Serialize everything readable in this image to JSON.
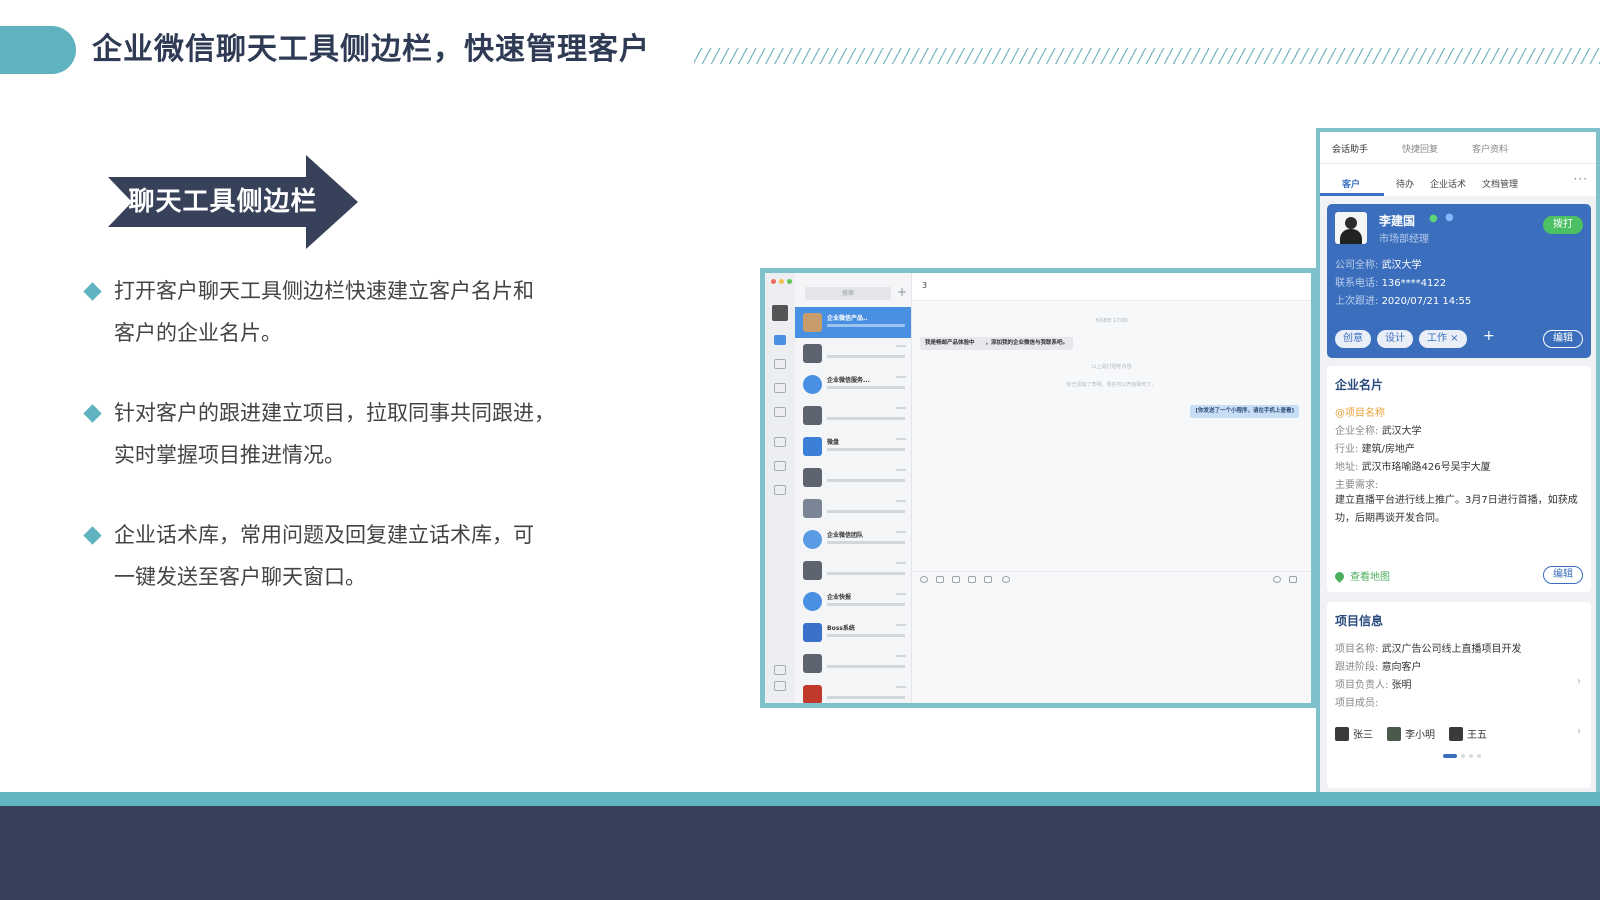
{
  "header": {
    "title": "企业微信聊天工具侧边栏，快速管理客户"
  },
  "banner": {
    "label": "聊天工具侧边栏"
  },
  "bullets": [
    {
      "line1": "打开客户聊天工具侧边栏快速建立客户名片和",
      "line2": "客户的企业名片。"
    },
    {
      "line1": "针对客户的跟进建立项目，拉取同事共同跟进，",
      "line2": "实时掌握项目推进情况。"
    },
    {
      "line1": "企业话术库，常用问题及回复建立话术库，可",
      "line2": "一键发送至客户聊天窗口。"
    }
  ],
  "colors": {
    "accent": "#5fb2bf",
    "dark": "#37415a",
    "title": "#2f3b55",
    "blue": "#3b6fbd"
  },
  "chat": {
    "search_placeholder": "搜索",
    "plus": "+",
    "header_name": "3",
    "time": "5月8日 17:00",
    "incoming": "我是畅邮产品体验中　　，添加我的企业微信与我联系吧。",
    "system1": "以上是打招呼内容",
    "system2": "你已添加了李明，现在可以开始聊天了。",
    "outgoing": "[你发送了一个小程序，请在手机上查看]",
    "contacts": [
      {
        "name": "企业微信产品.."
      },
      {
        "name": "企业微信服务..."
      },
      {
        "name": "微盘"
      },
      {
        "name": "企业微信团队"
      },
      {
        "name": "企业快报"
      },
      {
        "name": "Boss系统"
      }
    ]
  },
  "sidebar": {
    "top_tabs": [
      "会话助手",
      "快捷回复",
      "客户资料"
    ],
    "sub_tabs": [
      "客户",
      "待办",
      "企业话术",
      "文档管理"
    ],
    "more": "···",
    "customer": {
      "name": "李建国",
      "role": "市场部经理",
      "call": "拨打",
      "company_label": "公司全称:",
      "company": "武汉大学",
      "phone_label": "联系电话:",
      "phone": "136****4122",
      "followup_label": "上次跟进:",
      "followup": "2020/07/21 14:55",
      "tags": [
        "创意",
        "设计",
        "工作 ×"
      ],
      "add_tag": "+",
      "edit": "编辑"
    },
    "company_card": {
      "title": "企业名片",
      "project_name": "@项目名称",
      "name_label": "企业全称:",
      "name": "武汉大学",
      "industry_label": "行业:",
      "industry": "建筑/房地产",
      "address_label": "地址:",
      "address": "武汉市珞喻路426号吴宇大厦",
      "needs_label": "主要需求:",
      "needs": "建立直播平台进行线上推广。3月7日进行首播，如获成功，后期再谈开发合同。",
      "map": "查看地图",
      "edit": "编辑"
    },
    "project": {
      "title": "项目信息",
      "name_label": "项目名称:",
      "name": "武汉广告公司线上直播项目开发",
      "stage_label": "跟进阶段:",
      "stage": "意向客户",
      "owner_label": "项目负责人:",
      "owner": "张明",
      "members_label": "项目成员:",
      "members": [
        "张三",
        "李小明",
        "王五"
      ],
      "chevron": "›"
    }
  }
}
